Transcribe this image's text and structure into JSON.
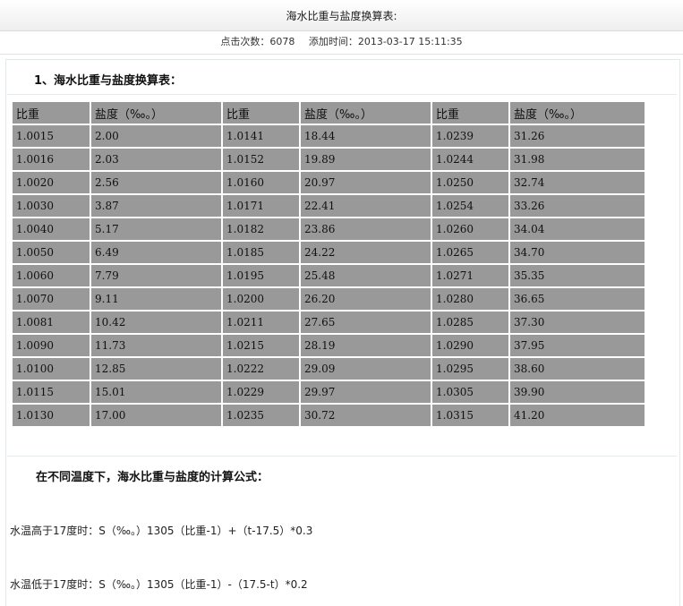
{
  "page": {
    "title": "海水比重与盐度换算表:",
    "clicks_label": "点击次数：6078",
    "added_label": "添加时间：2013-03-17 15:11:35"
  },
  "section": {
    "heading": "1、海水比重与盐度换算表：",
    "formula_heading": "在不同温度下，海水比重与盐度的计算公式：",
    "formula_high": "水温高于17度时：S（‰。）1305（比重-1）+（t-17.5）*0.3",
    "formula_low": "水温低于17度时：S（‰。）1305（比重-1）-（17.5-t）*0.2"
  },
  "table": {
    "headers": [
      "比重",
      "盐度（‰。）",
      "比重",
      "盐度（‰。）",
      "比重",
      "盐度（‰。）"
    ],
    "rows": [
      [
        "1.0015",
        "2.00",
        "1.0141",
        "18.44",
        "1.0239",
        "31.26"
      ],
      [
        "1.0016",
        "2.03",
        "1.0152",
        "19.89",
        "1.0244",
        "31.98"
      ],
      [
        "1.0020",
        "2.56",
        "1.0160",
        "20.97",
        "1.0250",
        "32.74"
      ],
      [
        "1.0030",
        "3.87",
        "1.0171",
        "22.41",
        "1.0254",
        "33.26"
      ],
      [
        "1.0040",
        "5.17",
        "1.0182",
        "23.86",
        "1.0260",
        "34.04"
      ],
      [
        "1.0050",
        "6.49",
        "1.0185",
        "24.22",
        "1.0265",
        "34.70"
      ],
      [
        "1.0060",
        "7.79",
        "1.0195",
        "25.48",
        "1.0271",
        "35.35"
      ],
      [
        "1.0070",
        "9.11",
        "1.0200",
        "26.20",
        "1.0280",
        "36.65"
      ],
      [
        "1.0081",
        "10.42",
        "1.0211",
        "27.65",
        "1.0285",
        "37.30"
      ],
      [
        "1.0090",
        "11.73",
        "1.0215",
        "28.19",
        "1.0290",
        "37.95"
      ],
      [
        "1.0100",
        "12.85",
        "1.0222",
        "29.09",
        "1.0295",
        "38.60"
      ],
      [
        "1.0115",
        "15.01",
        "1.0229",
        "29.97",
        "1.0305",
        "39.90"
      ],
      [
        "1.0130",
        "17.00",
        "1.0235",
        "30.72",
        "1.0315",
        "41.20"
      ]
    ]
  }
}
